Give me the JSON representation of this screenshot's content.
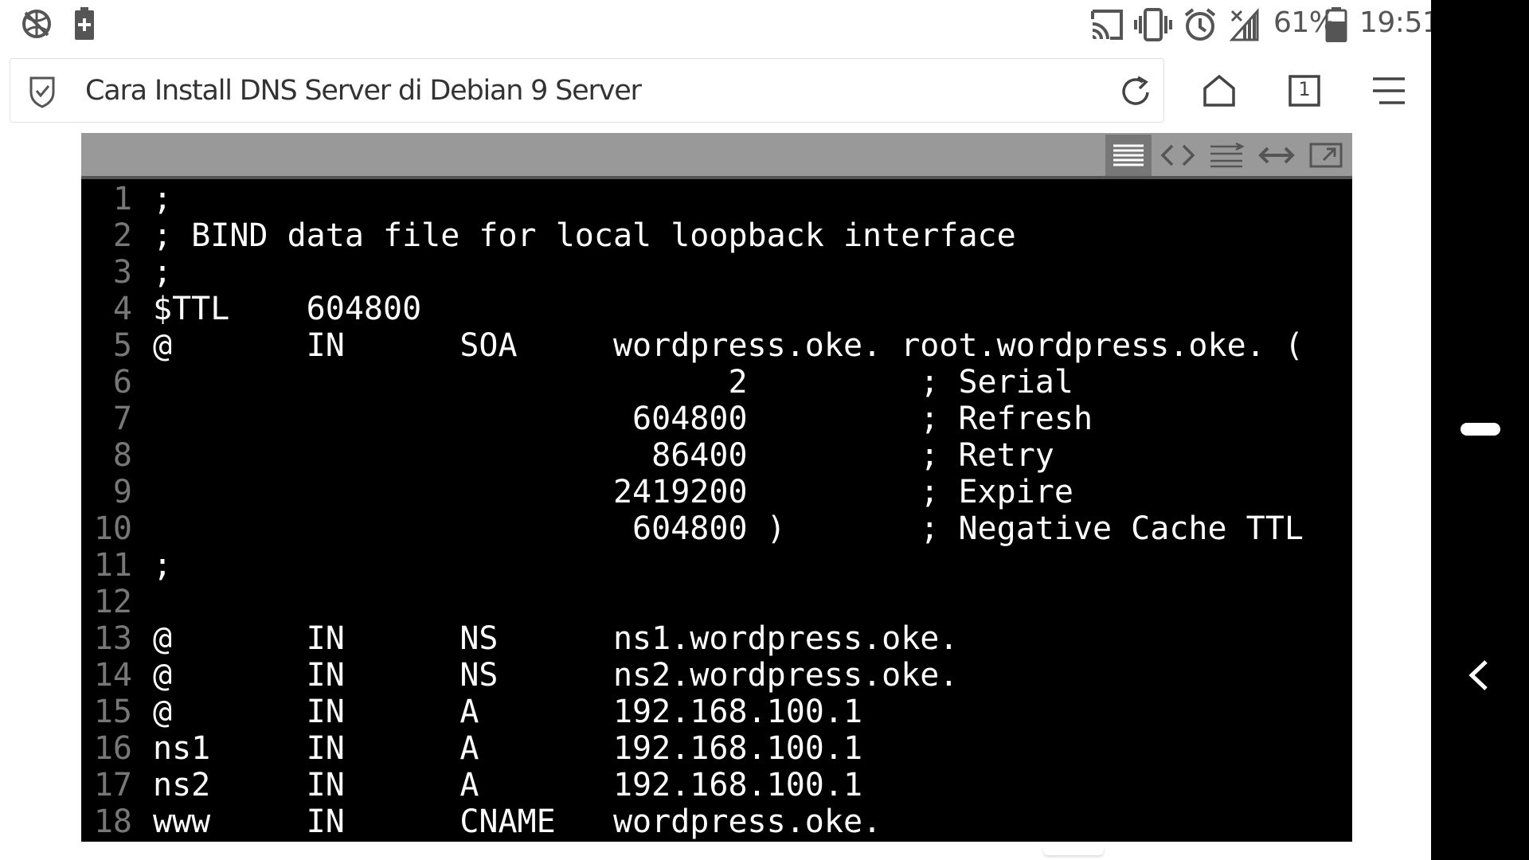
{
  "status_bar": {
    "battery_percent": "61%",
    "time": "19:51",
    "left_icons": [
      "no-network-icon",
      "battery-saver-icon"
    ],
    "right_icons": [
      "cast-icon",
      "vibrate-icon",
      "alarm-icon",
      "no-signal-icon",
      "battery-icon"
    ]
  },
  "browser": {
    "page_title": "Cara Install DNS Server di Debian 9 Server",
    "tab_count": "1",
    "icons": [
      "shield-check-icon",
      "reload-icon",
      "home-icon",
      "tabs-icon",
      "menu-icon"
    ]
  },
  "code_toolbar": {
    "buttons": [
      "view-source-icon",
      "show-code-icon",
      "wrap-lines-icon",
      "expand-icon",
      "open-new-window-icon"
    ]
  },
  "code": {
    "lines": [
      {
        "n": "1",
        "text": ";"
      },
      {
        "n": "2",
        "text": "; BIND data file for local loopback interface"
      },
      {
        "n": "3",
        "text": ";"
      },
      {
        "n": "4",
        "text": "$TTL    604800"
      },
      {
        "n": "5",
        "text": "@       IN      SOA     wordpress.oke. root.wordpress.oke. ("
      },
      {
        "n": "6",
        "text": "                              2         ; Serial"
      },
      {
        "n": "7",
        "text": "                         604800         ; Refresh"
      },
      {
        "n": "8",
        "text": "                          86400         ; Retry"
      },
      {
        "n": "9",
        "text": "                        2419200         ; Expire"
      },
      {
        "n": "10",
        "text": "                         604800 )       ; Negative Cache TTL"
      },
      {
        "n": "11",
        "text": ";"
      },
      {
        "n": "12",
        "text": ""
      },
      {
        "n": "13",
        "text": "@       IN      NS      ns1.wordpress.oke."
      },
      {
        "n": "14",
        "text": "@       IN      NS      ns2.wordpress.oke."
      },
      {
        "n": "15",
        "text": "@       IN      A       192.168.100.1"
      },
      {
        "n": "16",
        "text": "ns1     IN      A       192.168.100.1"
      },
      {
        "n": "17",
        "text": "ns2     IN      A       192.168.100.1"
      },
      {
        "n": "18",
        "text": "www     IN      CNAME   wordpress.oke."
      }
    ]
  },
  "colors": {
    "code_background": "#000000",
    "code_text": "#ffffff",
    "line_number": "#777777",
    "toolbar": "#999999"
  }
}
